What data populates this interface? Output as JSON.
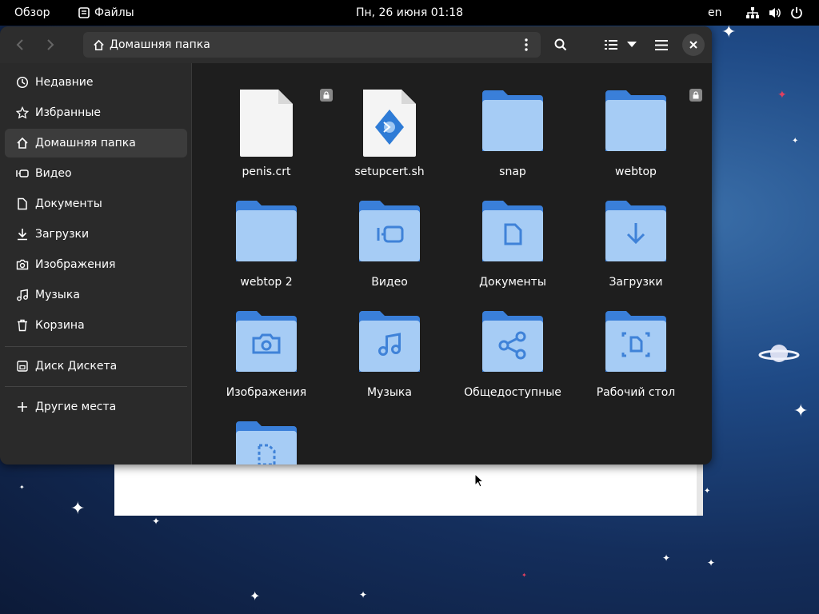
{
  "topbar": {
    "overview": "Обзор",
    "app_name": "Файлы",
    "clock": "Пн, 26 июня  01:18",
    "lang": "en"
  },
  "header": {
    "path": "Домашняя папка"
  },
  "sidebar": {
    "items": [
      {
        "label": "Недавние",
        "icon": "clock-icon"
      },
      {
        "label": "Избранные",
        "icon": "star-icon"
      },
      {
        "label": "Домашняя папка",
        "icon": "home-icon"
      },
      {
        "label": "Видео",
        "icon": "video-icon"
      },
      {
        "label": "Документы",
        "icon": "document-icon"
      },
      {
        "label": "Загрузки",
        "icon": "download-icon"
      },
      {
        "label": "Изображения",
        "icon": "image-icon"
      },
      {
        "label": "Музыка",
        "icon": "music-icon"
      },
      {
        "label": "Корзина",
        "icon": "trash-icon"
      }
    ],
    "drive": {
      "label": "Диск Дискета",
      "icon": "drive-icon"
    },
    "other": {
      "label": "Другие места",
      "icon": "plus-icon"
    }
  },
  "files": [
    {
      "name": "penis.crt",
      "type": "file",
      "locked": true
    },
    {
      "name": "setupcert.sh",
      "type": "script",
      "locked": false
    },
    {
      "name": "snap",
      "type": "folder",
      "emblem": ""
    },
    {
      "name": "webtop",
      "type": "folder",
      "emblem": "",
      "locked": true
    },
    {
      "name": "webtop 2",
      "type": "folder",
      "emblem": ""
    },
    {
      "name": "Видео",
      "type": "folder",
      "emblem": "video"
    },
    {
      "name": "Документы",
      "type": "folder",
      "emblem": "document"
    },
    {
      "name": "Загрузки",
      "type": "folder",
      "emblem": "download"
    },
    {
      "name": "Изображения",
      "type": "folder",
      "emblem": "camera"
    },
    {
      "name": "Музыка",
      "type": "folder",
      "emblem": "music"
    },
    {
      "name": "Общедоступные",
      "type": "folder",
      "emblem": "share"
    },
    {
      "name": "Рабочий стол",
      "type": "folder",
      "emblem": "desktop"
    },
    {
      "name": "",
      "type": "folder",
      "emblem": "template"
    }
  ],
  "colors": {
    "folder_back": "#3a7fd9",
    "folder_front": "#a6ccf5",
    "emblem": "#3f82d8",
    "window_bg": "#1e1e1e",
    "sidebar_bg": "#2a2a2a"
  }
}
